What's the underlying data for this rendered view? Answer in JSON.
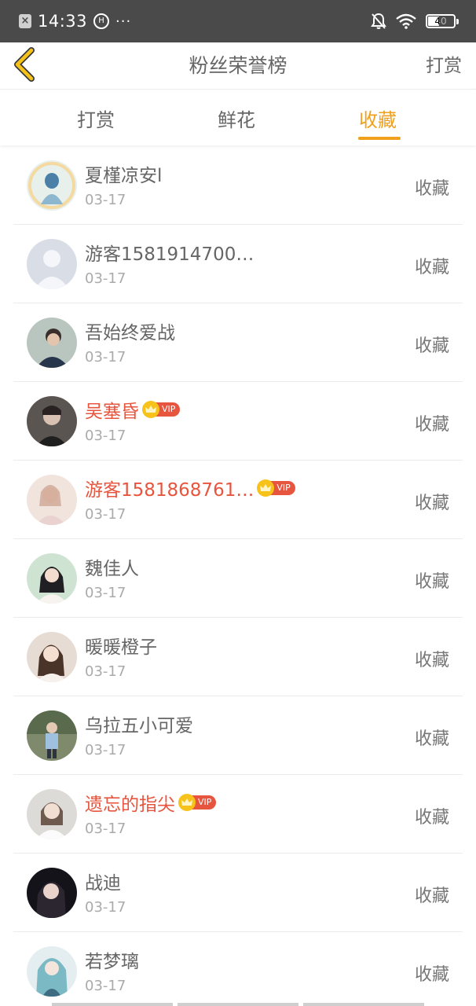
{
  "status_bar": {
    "time": "14:33",
    "circle_glyph": "H",
    "dots": "···",
    "battery": "40",
    "icons": [
      "notification-app-icon",
      "data-saver-icon",
      "bell-off-icon",
      "wifi-icon",
      "battery-icon"
    ]
  },
  "header": {
    "title": "粉丝荣誉榜",
    "right_link": "打赏",
    "back_icon": "chevron-left-icon"
  },
  "tabs": [
    {
      "label": "打赏",
      "active": false
    },
    {
      "label": "鲜花",
      "active": false
    },
    {
      "label": "收藏",
      "active": true
    }
  ],
  "colors": {
    "accent": "#f0a01c",
    "vip_name": "#e8553e",
    "status_bar": "#4a4a4a"
  },
  "list": [
    {
      "name": "夏槿凉安l",
      "date": "03-17",
      "action": "收藏",
      "vip": false
    },
    {
      "name": "游客1581914700…",
      "date": "03-17",
      "action": "收藏",
      "vip": false
    },
    {
      "name": "吾始终爱战",
      "date": "03-17",
      "action": "收藏",
      "vip": false
    },
    {
      "name": "吴塞昏",
      "date": "03-17",
      "action": "收藏",
      "vip": true,
      "vip_label": "VIP"
    },
    {
      "name": "游客1581868761…",
      "date": "03-17",
      "action": "收藏",
      "vip": true,
      "vip_label": "VIP"
    },
    {
      "name": "魏佳人",
      "date": "03-17",
      "action": "收藏",
      "vip": false
    },
    {
      "name": "暖暖橙子",
      "date": "03-17",
      "action": "收藏",
      "vip": false
    },
    {
      "name": "乌拉五小可爱",
      "date": "03-17",
      "action": "收藏",
      "vip": false
    },
    {
      "name": "遗忘的指尖",
      "date": "03-17",
      "action": "收藏",
      "vip": true,
      "vip_label": "VIP"
    },
    {
      "name": "战迪",
      "date": "03-17",
      "action": "收藏",
      "vip": false
    },
    {
      "name": "若梦璃",
      "date": "03-17",
      "action": "收藏",
      "vip": false
    }
  ]
}
